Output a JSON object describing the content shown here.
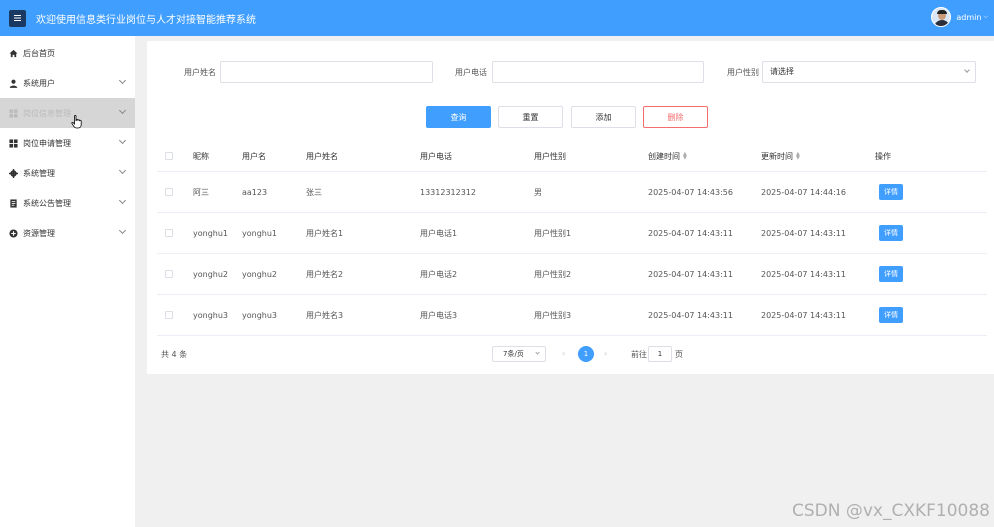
{
  "header": {
    "title": "欢迎使用信息类行业岗位与人才对接智能推荐系统",
    "username": "admin"
  },
  "sidebar": {
    "items": [
      {
        "label": "后台首页",
        "icon": "home-icon"
      },
      {
        "label": "系统用户",
        "icon": "user-icon"
      },
      {
        "label": "岗位信息管理",
        "icon": "grid-icon"
      },
      {
        "label": "岗位申请管理",
        "icon": "grid-icon"
      },
      {
        "label": "系统管理",
        "icon": "gear-icon"
      },
      {
        "label": "系统公告管理",
        "icon": "document-icon"
      },
      {
        "label": "资源管理",
        "icon": "plus-circle-icon"
      }
    ]
  },
  "filters": {
    "name_label": "用户姓名",
    "phone_label": "用户电话",
    "gender_label": "用户性别",
    "gender_placeholder": "请选择"
  },
  "actions": {
    "search": "查询",
    "reset": "重置",
    "add": "添加",
    "delete": "删除"
  },
  "table": {
    "columns": [
      "昵称",
      "用户名",
      "用户姓名",
      "用户电话",
      "用户性别",
      "创建时间",
      "更新时间",
      "操作"
    ],
    "rows": [
      {
        "nickname": "阿三",
        "username": "aa123",
        "realname": "张三",
        "phone": "13312312312",
        "gender": "男",
        "created": "2025-04-07 14:43:56",
        "updated": "2025-04-07 14:44:16",
        "action": "详情"
      },
      {
        "nickname": "yonghu1",
        "username": "yonghu1",
        "realname": "用户姓名1",
        "phone": "用户电话1",
        "gender": "用户性别1",
        "created": "2025-04-07 14:43:11",
        "updated": "2025-04-07 14:43:11",
        "action": "详情"
      },
      {
        "nickname": "yonghu2",
        "username": "yonghu2",
        "realname": "用户姓名2",
        "phone": "用户电话2",
        "gender": "用户性别2",
        "created": "2025-04-07 14:43:11",
        "updated": "2025-04-07 14:43:11",
        "action": "详情"
      },
      {
        "nickname": "yonghu3",
        "username": "yonghu3",
        "realname": "用户姓名3",
        "phone": "用户电话3",
        "gender": "用户性别3",
        "created": "2025-04-07 14:43:11",
        "updated": "2025-04-07 14:43:11",
        "action": "详情"
      }
    ]
  },
  "pagination": {
    "total": "共 4 条",
    "page_size": "7条/页",
    "current_page": "1",
    "goto_label": "前往",
    "goto_value": "1",
    "goto_suffix": "页"
  },
  "watermark": "CSDN @vx_CXKF10088",
  "colors": {
    "primary": "#409eff",
    "danger": "#f56c6c",
    "menu_toggle": "#1b3a63"
  }
}
